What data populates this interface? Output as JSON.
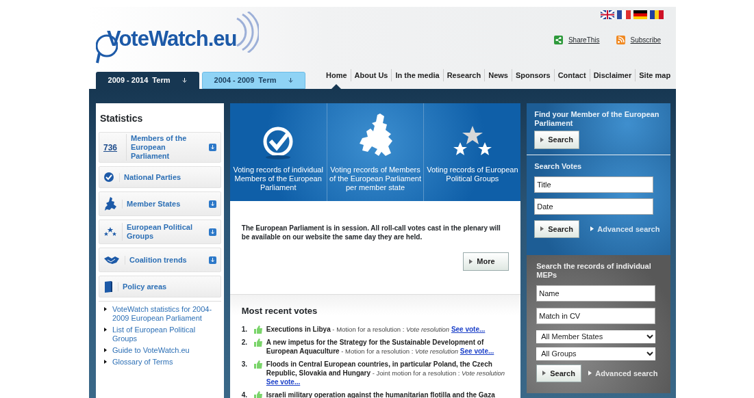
{
  "header": {
    "logo": "VoteWatch.eu",
    "share": "ShareThis",
    "subscribe": "Subscribe"
  },
  "terms": [
    {
      "label": "2009 - 2014  Term",
      "selected": true
    },
    {
      "label": "2004 - 2009  Term",
      "selected": false
    }
  ],
  "nav": [
    {
      "label": "Home",
      "selected": true
    },
    {
      "label": "About Us",
      "selected": false
    },
    {
      "label": "In the media",
      "selected": false
    },
    {
      "label": "Research",
      "selected": false
    },
    {
      "label": "News",
      "selected": false
    },
    {
      "label": "Sponsors",
      "selected": false
    },
    {
      "label": "Contact",
      "selected": false
    },
    {
      "label": "Disclaimer",
      "selected": false
    },
    {
      "label": "Site map",
      "selected": false
    }
  ],
  "statistics": {
    "title": "Statistics",
    "items": [
      {
        "kind": "count",
        "count": "736",
        "label": "Members of the European Parliament",
        "expandable": true
      },
      {
        "kind": "parties",
        "label": "National Parties",
        "expandable": false
      },
      {
        "kind": "states",
        "label": "Member States",
        "expandable": true
      },
      {
        "kind": "groups",
        "label": "European Political Groups",
        "expandable": true
      },
      {
        "kind": "coalition",
        "label": "Coalition trends",
        "expandable": true
      },
      {
        "kind": "policy",
        "label": "Policy areas",
        "expandable": false
      }
    ],
    "links": [
      "VoteWatch statistics for 2004-2009 European Parliament",
      "List of European Political Groups",
      "Guide to VoteWatch.eu",
      "Glossary of Terms"
    ]
  },
  "banner": [
    {
      "kind": "check",
      "label": "Voting records of individual Members of the European Parliament"
    },
    {
      "kind": "map",
      "label": "Voting records of Members of the European Parliament per member state"
    },
    {
      "kind": "stars",
      "label": "Voting records of European Political Groups"
    }
  ],
  "notice": {
    "text": "The European Parliament is in session. All roll-call votes cast in the plenary will be available on our website the same day they are held.",
    "button": "More"
  },
  "recent_votes": {
    "title": "Most recent votes",
    "items": [
      {
        "number": "1.",
        "title": "Executions in Libya",
        "type": "- Motion for a resolution :",
        "result": "Vote resolution",
        "link": "See vote..."
      },
      {
        "number": "2.",
        "title": "A new impetus for the Strategy for the Sustainable Development of European Aquaculture",
        "type": "- Motion for a resolution :",
        "result": "Vote resolution",
        "link": "See vote..."
      },
      {
        "number": "3.",
        "title": "Floods in Central European countries, in particular Poland, the Czech Republic, Slovakia and Hungary",
        "type": "- Joint motion for a resolution :",
        "result": "Vote resolution",
        "link": "See vote..."
      },
      {
        "number": "4.",
        "title": "Israeli military operation against the humanitarian flotilla and the Gaza"
      }
    ]
  },
  "find_member": {
    "title": "Find your Member of the European Parliament",
    "button": "Search"
  },
  "search_votes": {
    "title": "Search Votes",
    "fields": [
      {
        "value": "Title"
      },
      {
        "value": "Date"
      }
    ],
    "button": "Search",
    "advanced": "Advanced search"
  },
  "search_meps": {
    "title": "Search the records of individual MEPs",
    "fields": [
      {
        "value": "Name"
      },
      {
        "value": "Match in CV"
      }
    ],
    "selects": [
      {
        "value": "All Member States"
      },
      {
        "value": "All Groups"
      }
    ],
    "button": "Search",
    "advanced": "Advanced search"
  }
}
